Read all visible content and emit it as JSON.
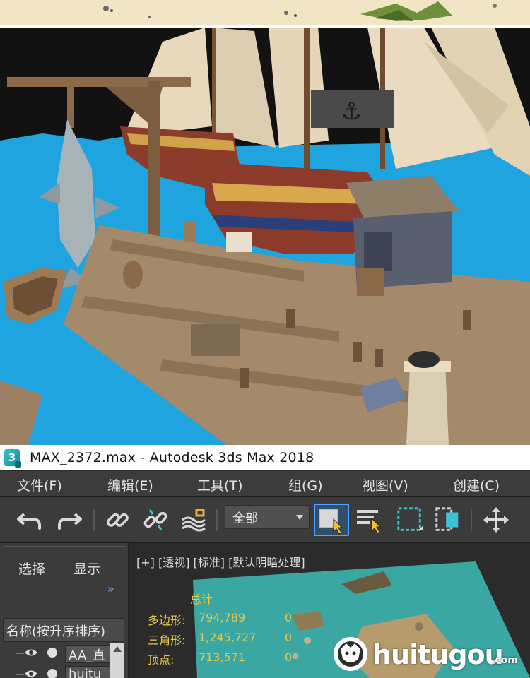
{
  "window": {
    "title": "MAX_2372.max - Autodesk 3ds Max 2018",
    "logo_text": "3"
  },
  "menubar": {
    "items": [
      {
        "label": "文件(F)"
      },
      {
        "label": "编辑(E)"
      },
      {
        "label": "工具(T)"
      },
      {
        "label": "组(G)"
      },
      {
        "label": "视图(V)"
      },
      {
        "label": "创建(C)"
      }
    ]
  },
  "toolbar": {
    "selection_filter": "全部",
    "icons": [
      "undo-icon",
      "redo-icon",
      "link-icon",
      "unlink-icon",
      "bind-space-warp-icon",
      "select-object-icon",
      "select-by-name-icon",
      "rectangular-selection-icon",
      "window-crossing-icon",
      "move-icon"
    ]
  },
  "scene_explorer": {
    "tabs": [
      "选择",
      "显示"
    ],
    "column_header": "名称(按升序排序)",
    "rows": [
      {
        "name": "AA_直"
      },
      {
        "name": "huitu"
      }
    ]
  },
  "viewport": {
    "labels": "[+] [透视] [标准] [默认明暗处理]",
    "stats": {
      "header": "总计",
      "rows": [
        {
          "label": "多边形:",
          "value": "794,789",
          "selected": "0"
        },
        {
          "label": "三角形:",
          "value": "1,245,727",
          "selected": "0"
        },
        {
          "label": "顶点:",
          "value": "713,571",
          "selected": "0"
        }
      ]
    }
  },
  "watermark": {
    "text": "huitugou",
    "suffix": ".com"
  },
  "colors": {
    "water": "#1fa4e0",
    "sand": "#f1e5c6",
    "ui_dark": "#3b3b3b",
    "stats_yellow": "#e8c84a",
    "accent_blue": "#4da3ff"
  }
}
